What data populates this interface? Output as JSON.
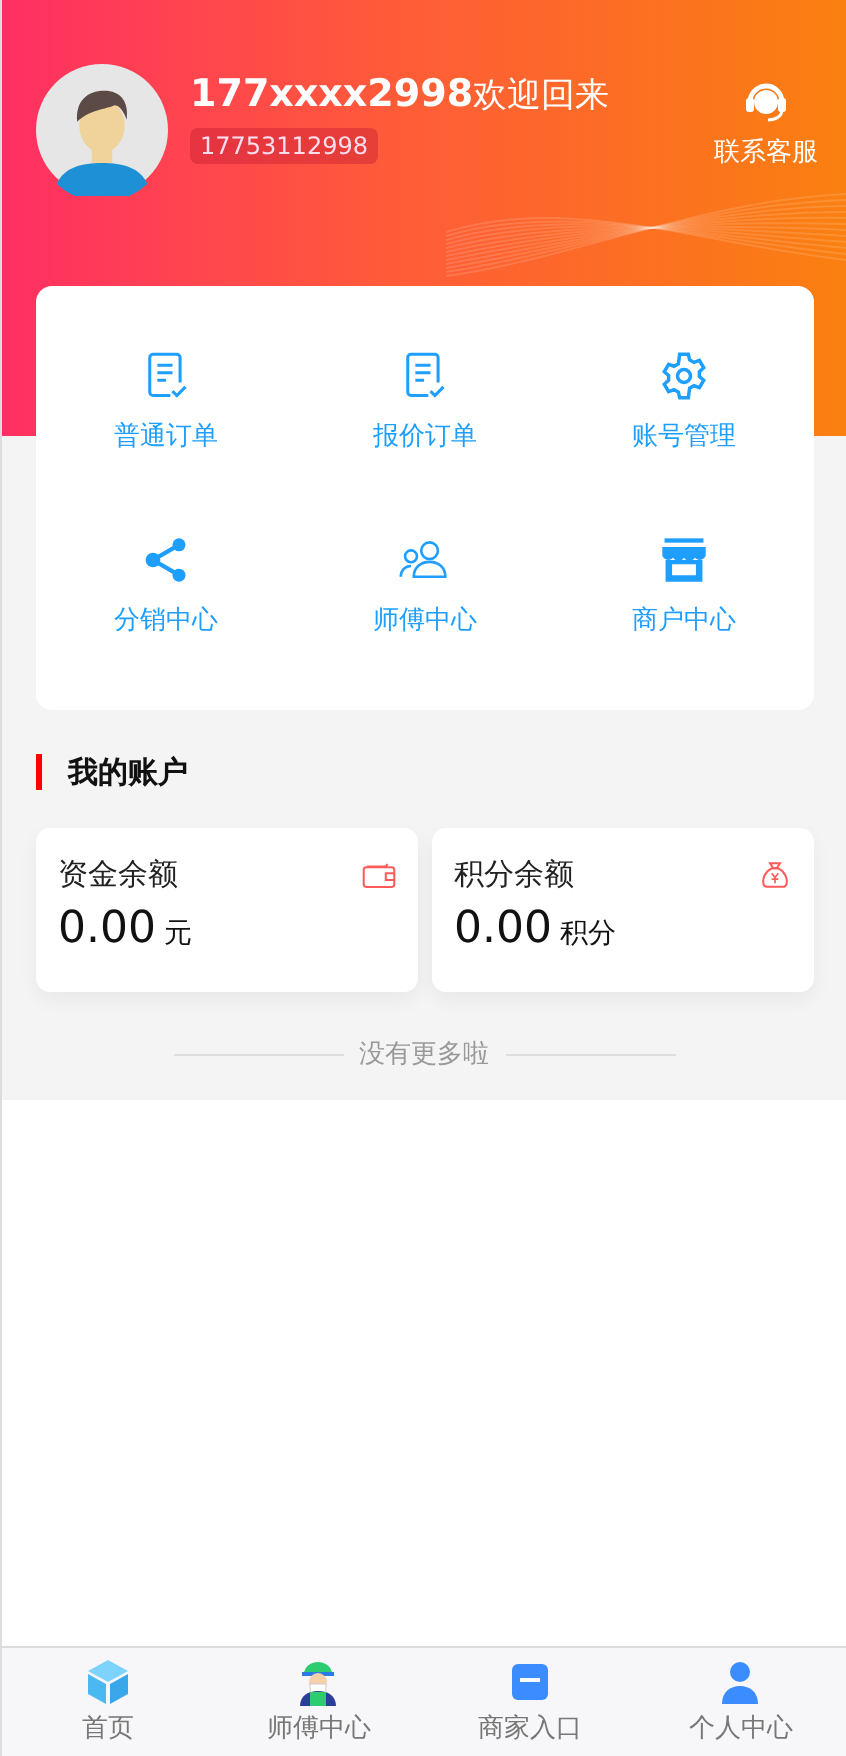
{
  "header": {
    "nickname": "177xxxx2998",
    "greeting": "欢迎回来",
    "phone": "17753112998",
    "service_label": "联系客服"
  },
  "menu": [
    {
      "kind": "order",
      "label": "普通订单"
    },
    {
      "kind": "order",
      "label": "报价订单"
    },
    {
      "kind": "settings",
      "label": "账号管理"
    },
    {
      "kind": "share",
      "label": "分销中心"
    },
    {
      "kind": "people",
      "label": "师傅中心"
    },
    {
      "kind": "store",
      "label": "商户中心"
    }
  ],
  "section_title": "我的账户",
  "accounts": [
    {
      "kind": "wallet",
      "label": "资金余额",
      "amount": "0.00",
      "unit": "元"
    },
    {
      "kind": "moneybag",
      "label": "积分余额",
      "amount": "0.00",
      "unit": "积分"
    }
  ],
  "end_note": "没有更多啦",
  "tabbar": [
    {
      "kind": "home",
      "label": "首页",
      "selected": false
    },
    {
      "kind": "worker",
      "label": "师傅中心",
      "selected": false
    },
    {
      "kind": "shop",
      "label": "商家入口",
      "selected": false
    },
    {
      "kind": "person",
      "label": "个人中心",
      "selected": false
    }
  ]
}
